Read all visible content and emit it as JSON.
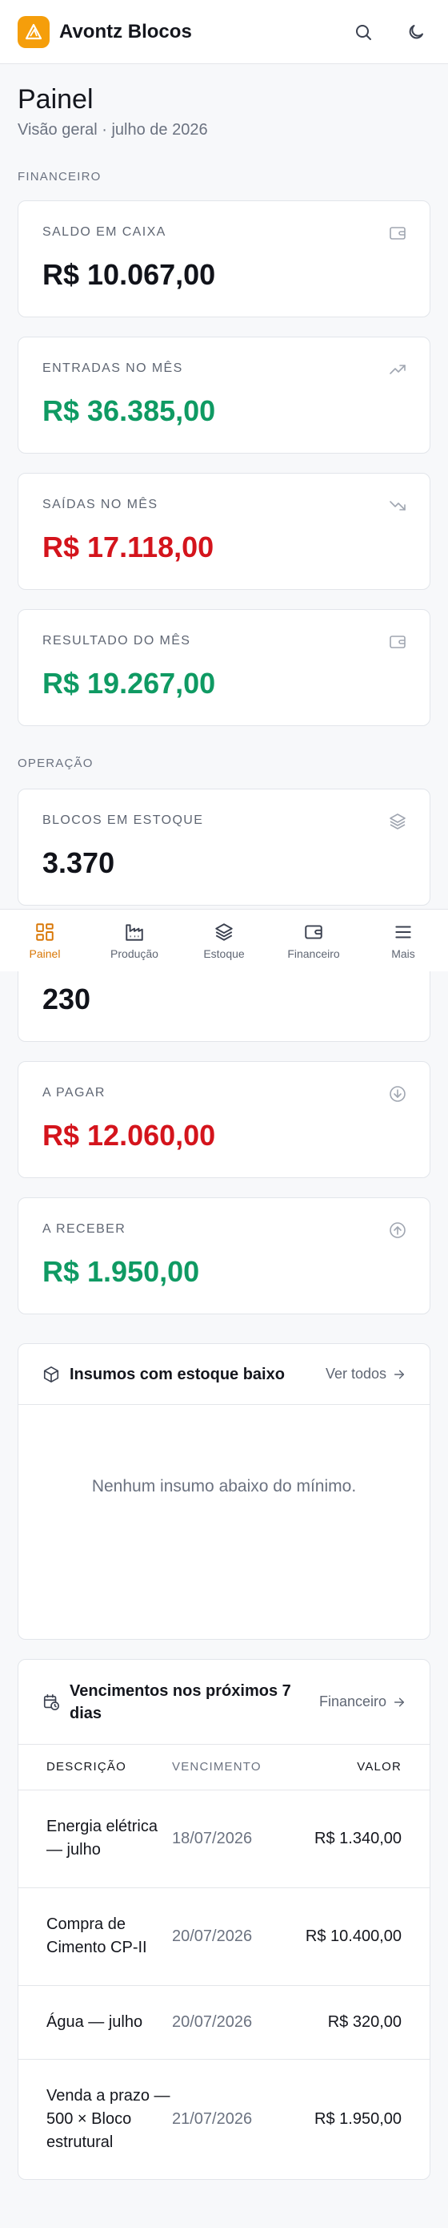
{
  "app": {
    "name": "Avontz Blocos"
  },
  "header": {
    "search_icon": "search-icon",
    "theme_icon": "moon-icon"
  },
  "page": {
    "title": "Painel",
    "subtitle": "Visão geral · julho de 2026"
  },
  "sections": {
    "financial": "FINANCEIRO",
    "operation": "OPERAÇÃO"
  },
  "financial": {
    "cash": {
      "label": "SALDO EM CAIXA",
      "value": "R$ 10.067,00",
      "icon": "wallet-icon"
    },
    "income": {
      "label": "ENTRADAS NO MÊS",
      "value": "R$ 36.385,00",
      "icon": "trending-up-icon"
    },
    "expenses": {
      "label": "SAÍDAS NO MÊS",
      "value": "R$ 17.118,00",
      "icon": "trending-down-icon"
    },
    "result": {
      "label": "RESULTADO DO MÊS",
      "value": "R$ 19.267,00",
      "icon": "wallet-icon"
    }
  },
  "operation": {
    "stock": {
      "label": "BLOCOS EM ESTOQUE",
      "value": "3.370",
      "icon": "layers-icon"
    },
    "hidden": {
      "value": "230"
    },
    "payable": {
      "label": "A PAGAR",
      "value": "R$ 12.060,00",
      "icon": "arrow-down-circle-icon"
    },
    "receivable": {
      "label": "A RECEBER",
      "value": "R$ 1.950,00",
      "icon": "arrow-up-circle-icon"
    }
  },
  "low_stock": {
    "title": "Insumos com estoque baixo",
    "link": "Ver todos",
    "empty": "Nenhum insumo abaixo do mínimo."
  },
  "due": {
    "title": "Vencimentos nos próximos 7 dias",
    "link": "Financeiro",
    "columns": {
      "desc": "DESCRIÇÃO",
      "date": "VENCIMENTO",
      "value": "VALOR"
    },
    "rows": [
      {
        "desc": "Energia elétrica — julho",
        "date": "18/07/2026",
        "value": "R$ 1.340,00"
      },
      {
        "desc": "Compra de Cimento CP-II",
        "date": "20/07/2026",
        "value": "R$ 10.400,00"
      },
      {
        "desc": "Água — julho",
        "date": "20/07/2026",
        "value": "R$ 320,00"
      },
      {
        "desc": "Venda a prazo — 500 × Bloco estrutural",
        "date": "21/07/2026",
        "value": "R$ 1.950,00"
      }
    ]
  },
  "nav": {
    "items": [
      {
        "label": "Painel",
        "icon": "dashboard-icon",
        "active": true
      },
      {
        "label": "Produção",
        "icon": "factory-icon"
      },
      {
        "label": "Estoque",
        "icon": "layers-icon"
      },
      {
        "label": "Financeiro",
        "icon": "wallet-icon"
      },
      {
        "label": "Mais",
        "icon": "menu-icon"
      }
    ]
  },
  "colors": {
    "accent": "#f59e0b",
    "positive": "#0f9a63",
    "negative": "#d4141c",
    "active_nav": "#d97706"
  }
}
